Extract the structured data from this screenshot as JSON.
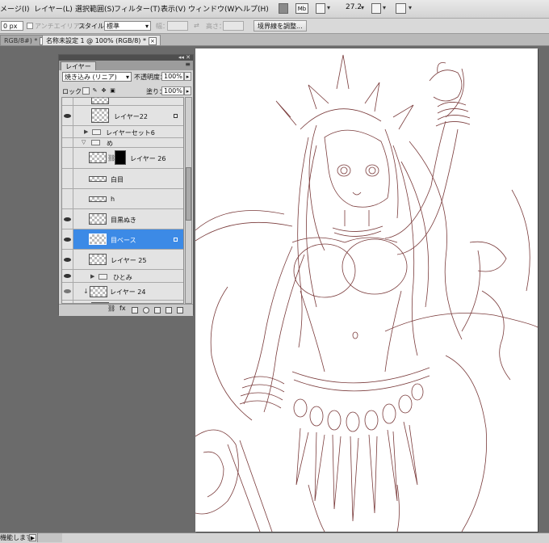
{
  "menu": {
    "items": [
      "メージ(I)",
      "レイヤー(L)",
      "選択範囲(S)",
      "フィルター(T)",
      "表示(V)",
      "ウィンドウ(W)",
      "ヘルプ(H)"
    ],
    "zoom": "27.2"
  },
  "options": {
    "feather_value": "0 px",
    "antialias_label": "アンチエイリアス",
    "style_label": "スタイル：",
    "style_value": "標準",
    "width_label": "幅：",
    "height_label": "高さ：",
    "refine_edge_button": "境界線を調整..."
  },
  "tabs": [
    {
      "label": "RGB/8#) *"
    },
    {
      "label": "名称未設定 1 @ 100% (RGB/8) *"
    }
  ],
  "layers_panel": {
    "tab_label": "レイヤー",
    "blend_mode": "焼き込み (リニア)",
    "opacity_label": "不透明度：",
    "opacity_value": "100%",
    "lock_label": "ロック：",
    "fill_label": "塗り：",
    "fill_value": "100%",
    "layers": [
      {
        "name": "レイヤー22",
        "visible": true,
        "kind": "layer"
      },
      {
        "name": "レイヤーセット6",
        "visible": false,
        "kind": "group-collapsed"
      },
      {
        "name": "め",
        "visible": false,
        "kind": "group-open"
      },
      {
        "name": "レイヤー 26",
        "visible": false,
        "kind": "layer-mask"
      },
      {
        "name": "白目",
        "visible": false,
        "kind": "layer-flat"
      },
      {
        "name": "h",
        "visible": false,
        "kind": "layer-flat"
      },
      {
        "name": "目黒ぬき",
        "visible": true,
        "kind": "layer"
      },
      {
        "name": "目ベース",
        "visible": true,
        "kind": "layer",
        "selected": true
      },
      {
        "name": "レイヤー 25",
        "visible": true,
        "kind": "layer"
      },
      {
        "name": "ひとみ",
        "visible": true,
        "kind": "group-collapsed"
      },
      {
        "name": "レイヤー 24",
        "visible": true,
        "kind": "layer-clipped"
      }
    ]
  },
  "status": {
    "text": "機能します"
  },
  "colors": {
    "selection": "#3c8ae6",
    "lineart": "#7a3b3b"
  }
}
